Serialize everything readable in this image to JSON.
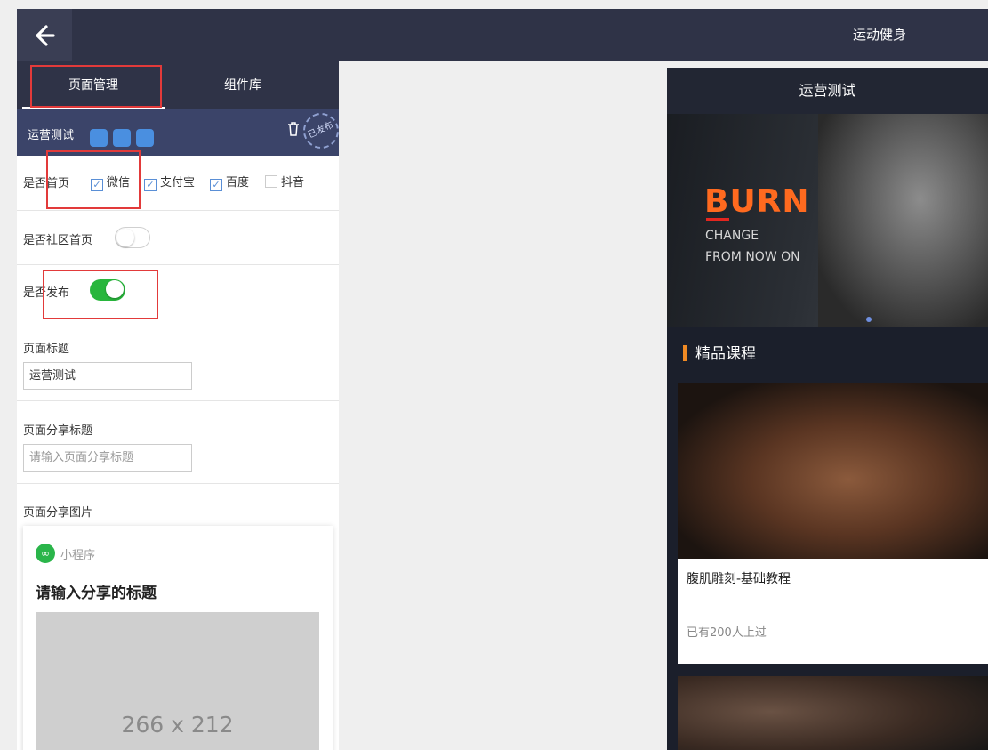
{
  "header": {
    "back_icon": "arrow-left-icon",
    "title": "运动健身"
  },
  "left_panel": {
    "tabs": [
      {
        "label": "页面管理",
        "active": true
      },
      {
        "label": "组件库",
        "active": false
      }
    ],
    "page_bar": {
      "page_name": "运营测试",
      "platform_icons": [
        "wechat-icon",
        "alipay-icon",
        "baidu-icon"
      ],
      "delete_icon": "trash-icon",
      "stamp": "已发布"
    },
    "home_setting": {
      "label": "是否首页",
      "options": [
        {
          "label": "微信",
          "checked": true
        },
        {
          "label": "支付宝",
          "checked": true
        },
        {
          "label": "百度",
          "checked": true
        },
        {
          "label": "抖音",
          "checked": false
        }
      ]
    },
    "community_home": {
      "label": "是否社区首页",
      "on": false
    },
    "publish": {
      "label": "是否发布",
      "on": true
    },
    "page_title": {
      "label": "页面标题",
      "value": "运营测试"
    },
    "share_title": {
      "label": "页面分享标题",
      "placeholder": "请输入页面分享标题"
    },
    "share_image": {
      "label": "页面分享图片",
      "mini_program_label": "小程序",
      "title": "请输入分享的标题",
      "placeholder_size": "266 x 212"
    }
  },
  "preview": {
    "title": "运营测试",
    "banner": {
      "headline": "BURN",
      "line1": "CHANGE",
      "line2": "FROM NOW ON"
    },
    "section_title": "精品课程",
    "course": {
      "name": "腹肌雕刻-基础教程",
      "meta": "已有200人上过"
    }
  }
}
